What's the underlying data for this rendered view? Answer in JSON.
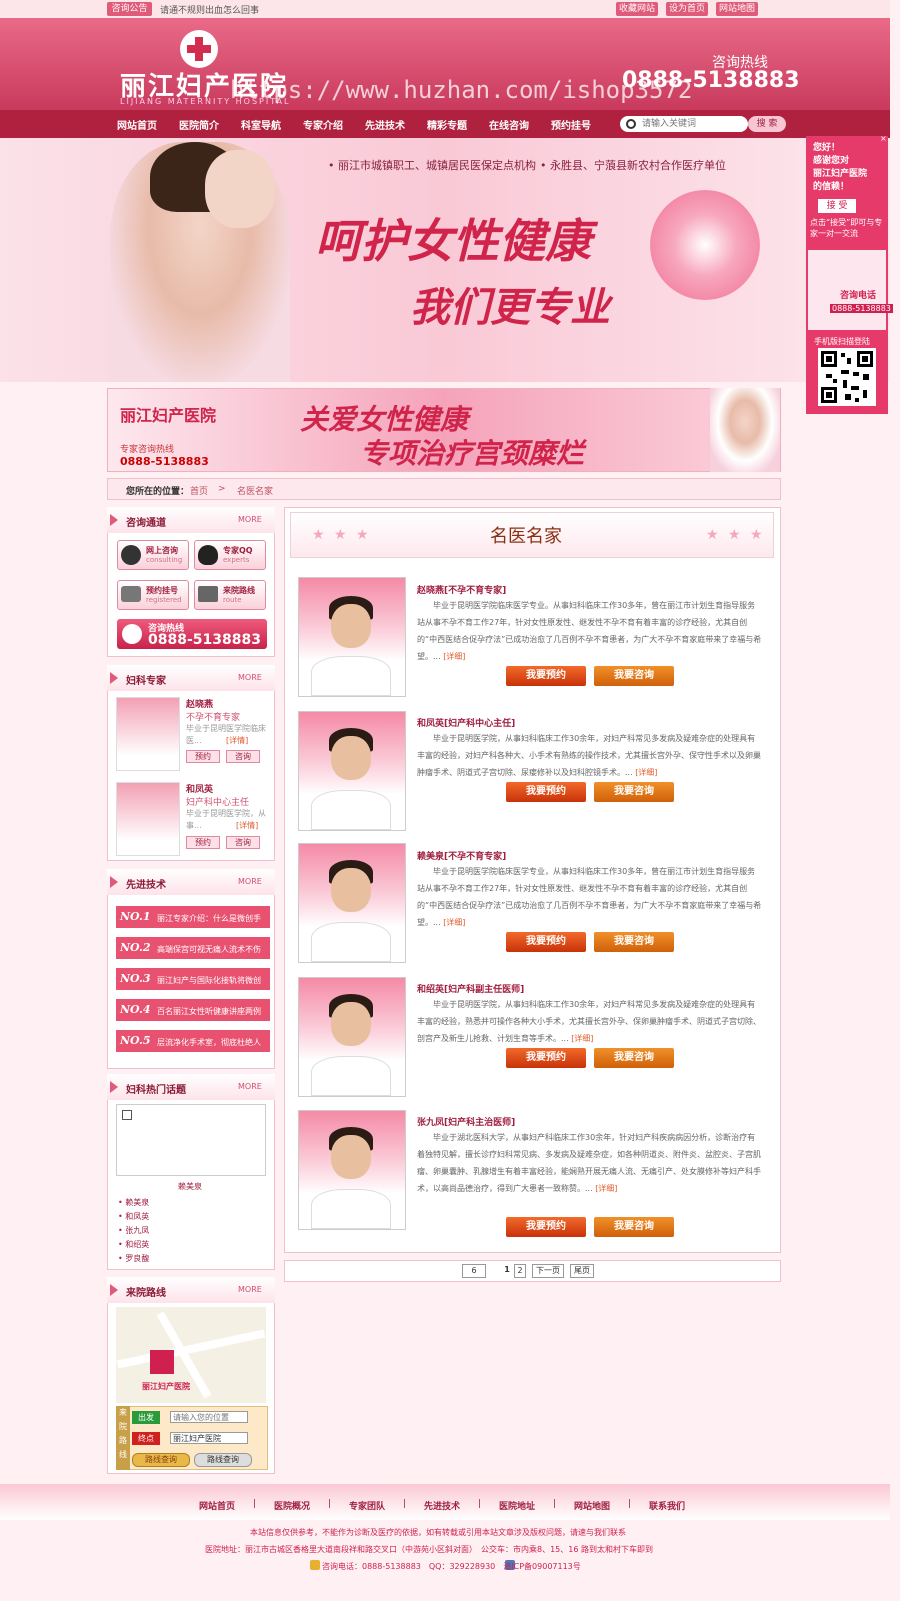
{
  "topbar": {
    "notice_badge": "咨询公告",
    "notice_text": "请通不规则出血怎么回事",
    "links": [
      "收藏网站",
      "设为首页",
      "网站地图"
    ]
  },
  "header": {
    "logo_name": "丽江妇产医院",
    "logo_en": "LIJIANG MATERNITY HOSPITAL",
    "watermark": "https://www.huzhan.com/ishop3572",
    "hotline_label": "咨询热线",
    "hotline_number": "0888-5138883"
  },
  "nav": {
    "items": [
      "网站首页",
      "医院简介",
      "科室导航",
      "专家介绍",
      "先进技术",
      "精彩专题",
      "在线咨询",
      "预约挂号"
    ],
    "search_placeholder": "请输入关键词",
    "search_button": "搜 索"
  },
  "banner": {
    "note1": "• 丽江市城镇职工、城镇居民医保定点机构",
    "note2": "• 永胜县、宁蒗县新农村合作医疗单位",
    "slogan1": "呵护女性健康",
    "slogan2": "我们更专业"
  },
  "side_float": {
    "thanks": "您好！\n感谢您对\n丽江妇产医院\n的信赖！",
    "accept": "接 受",
    "tip": "点击“接受”即可与专家一对一交流",
    "phone_label": "咨询电话",
    "phone_number": "0888-5138883",
    "qr_label": "手机版扫描登陆",
    "close": "×"
  },
  "ad_strip": {
    "logo": "丽江妇产医院",
    "text1": "关爱女性健康",
    "text2": "专项治疗宫颈糜烂",
    "phone_label": "专家咨询热线",
    "phone_number": "0888-5138883"
  },
  "breadcrumb": {
    "label": "您所在的位置：",
    "home": "首页",
    "sep": ">",
    "current": "名医名家"
  },
  "sidebar": {
    "more": "MORE",
    "consult": {
      "title": "咨询通道",
      "buttons": [
        {
          "label": "网上咨询",
          "sub": "consulting"
        },
        {
          "label": "专家QQ",
          "sub": "experts"
        },
        {
          "label": "预约挂号",
          "sub": "registered"
        },
        {
          "label": "来院路线",
          "sub": "route"
        }
      ],
      "hotline_label": "咨询热线",
      "hotline_number": "0888-5138883"
    },
    "experts": {
      "title": "妇科专家",
      "items": [
        {
          "name": "赵晓燕",
          "title": "不孕不育专家",
          "desc": "毕业于昆明医学院临床医...",
          "detail": "[详情]",
          "book": "预约",
          "ask": "咨询"
        },
        {
          "name": "和凤英",
          "title": "妇产科中心主任",
          "desc": "毕业于昆明医学院，从事...",
          "detail": "[详情]",
          "book": "预约",
          "ask": "咨询"
        }
      ]
    },
    "tech": {
      "title": "先进技术",
      "items": [
        {
          "no": "NO.1",
          "text": "丽江专家介绍：什么是微创手"
        },
        {
          "no": "NO.2",
          "text": "高端保宫可视无痛人流术不伤"
        },
        {
          "no": "NO.3",
          "text": "丽江妇产与国际化接轨将微创"
        },
        {
          "no": "NO.4",
          "text": "百名丽江女性听健康讲座两例"
        },
        {
          "no": "NO.5",
          "text": "层流净化手术室，彻底杜绝人"
        }
      ]
    },
    "hot": {
      "title": "妇科热门话题",
      "caption": "赖美泉",
      "links": [
        "赖美泉",
        "和凤英",
        "张九凤",
        "和绍英",
        "罗良馥"
      ]
    },
    "route": {
      "title": "来院路线",
      "side_label": "来院路线",
      "start_tag": "出发",
      "start_placeholder": "请输入您的位置",
      "end_tag": "终点",
      "end_value": "丽江妇产医院",
      "btn1": "路线查询",
      "btn2": "路线查询",
      "map_marker": "丽江妇产医院"
    }
  },
  "main": {
    "title": "名医名家",
    "book_label": "我要预约",
    "ask_label": "我要咨询",
    "doctors": [
      {
        "name": "赵晓燕[不孕不育专家]",
        "desc": "毕业于昆明医学院临床医学专业。从事妇科临床工作30多年，曾在丽江市计划生育指导服务站从事不孕不育工作27年，针对女性原发性、继发性不孕不育有着丰富的诊疗经验，尤其自创的“中西医结合促孕疗法”已成功治愈了几百例不孕不育患者，为广大不孕不育家庭带来了幸福与希望。...",
        "more": "[详细]"
      },
      {
        "name": "和凤英[妇产科中心主任]",
        "desc": "毕业于昆明医学院，从事妇科临床工作30余年，对妇产科常见多发病及疑难杂症的处理具有丰富的经验，对妇产科各种大、小手术有熟练的操作技术，尤其擅长宫外孕、保守性手术以及卵巢肿瘤手术、阴道式子宫切除、尿瘘修补以及妇科腔镜手术。...",
        "more": "[详细]"
      },
      {
        "name": "赖美泉[不孕不育专家]",
        "desc": "毕业于昆明医学院临床医学专业，从事妇科临床工作30多年，曾在丽江市计划生育指导服务站从事不孕不育工作27年，针对女性原发性、继发性不孕不育有着丰富的诊疗经验，尤其自创的“中西医结合促孕疗法”已成功治愈了几百例不孕不育患者，为广大不孕不育家庭带来了幸福与希望。...",
        "more": "[详细]"
      },
      {
        "name": "和绍英[妇产科副主任医师]",
        "desc": "毕业于昆明医学院，从事妇科临床工作30余年，对妇产科常见多发病及疑难杂症的处理具有丰富的经验，熟悉并可操作各种大小手术，尤其擅长宫外孕、保卵巢肿瘤手术、阴道式子宫切除、剖宫产及新生儿抢救、计划生育等手术。...",
        "more": "[详细]"
      },
      {
        "name": "张九凤[妇产科主治医师]",
        "desc": "毕业于湖北医科大学，从事妇产科临床工作30余年，针对妇产科疾病病因分析，诊断治疗有着独特见解，擅长诊疗妇科常见病、多发病及疑难杂症，如各种阴道炎、附件炎、盆腔炎、子宫肌瘤、卵巢囊肿、乳腺增生有着丰富经验，能娴熟开展无痛人流、无痛引产、处女膜修补等妇产科手术，以高尚品德治疗，得到广大患者一致称赞。...",
        "more": "[详细]"
      }
    ],
    "pager": {
      "total": "6",
      "page1": "1",
      "page2": "2",
      "next": "下一页",
      "last": "尾页"
    }
  },
  "footer": {
    "links": [
      "网站首页",
      "医院概况",
      "专家团队",
      "先进技术",
      "医院地址",
      "网站地图",
      "联系我们"
    ],
    "line1": "本站信息仅供参考，不能作为诊断及医疗的依据，如有转载或引用本站文章涉及版权问题，请速与我们联系",
    "line2": "医院地址：丽江市古城区香格里大道南段祥和路交叉口（中游苑小区斜对面）　公交车：市内乘8、15、16 路到太和村下车即到",
    "line3": "咨询电话：0888-5138883　QQ：329228930　滇ICP备09007113号"
  }
}
